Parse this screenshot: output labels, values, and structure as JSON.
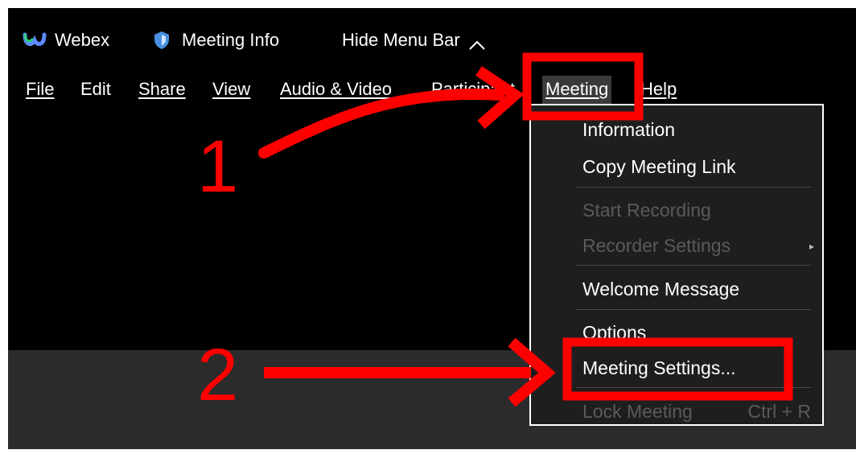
{
  "titlebar": {
    "app_name": "Webex",
    "meeting_info": "Meeting Info",
    "hide_menu_bar": "Hide Menu Bar",
    "hide_arrow": "^"
  },
  "menubar": {
    "file": "File",
    "edit": "Edit",
    "share": "Share",
    "view": "View",
    "audio_video": "Audio & Video",
    "participant": "Participant",
    "meeting": "Meeting",
    "help": "Help"
  },
  "meeting_menu": {
    "information": "Information",
    "copy_link": "Copy Meeting Link",
    "start_recording": "Start Recording",
    "recorder_settings": "Recorder Settings",
    "welcome_message": "Welcome Message",
    "options": "Options",
    "meeting_settings": "Meeting Settings...",
    "lock_meeting": "Lock Meeting",
    "lock_shortcut": "Ctrl + R"
  },
  "annotations": {
    "step1": "1",
    "step2": "2",
    "color": "#ff0000"
  },
  "colors": {
    "window_bg": "#000000",
    "menu_bg": "#1e1e1e",
    "disabled_text": "#5a5a5a",
    "webex_logo": "#3b5bdb",
    "shield": "#4a90e2"
  }
}
